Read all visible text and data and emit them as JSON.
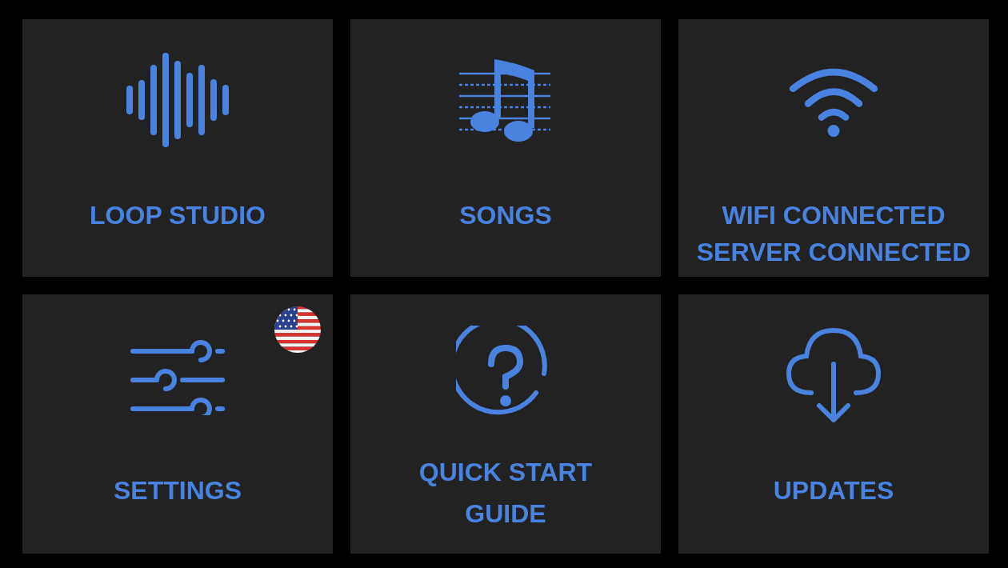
{
  "tiles": [
    {
      "kind": "waveform",
      "lines": [
        "LOOP STUDIO"
      ],
      "flag_badge": false
    },
    {
      "kind": "music",
      "lines": [
        "SONGS"
      ],
      "flag_badge": false
    },
    {
      "kind": "wifi",
      "lines": [
        "WIFI CONNECTED",
        "SERVER CONNECTED"
      ],
      "flag_badge": false
    },
    {
      "kind": "sliders",
      "lines": [
        "SETTINGS"
      ],
      "flag_badge": true
    },
    {
      "kind": "help",
      "lines": [
        "QUICK START GUIDE"
      ],
      "flag_badge": false
    },
    {
      "kind": "download",
      "lines": [
        "UPDATES"
      ],
      "flag_badge": false
    }
  ]
}
